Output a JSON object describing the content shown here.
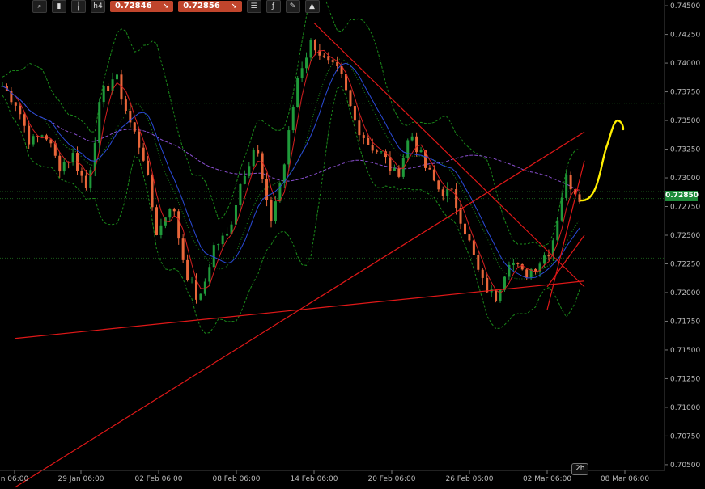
{
  "toolbar": {
    "tools": [
      {
        "icon": "zoom-icon",
        "glyph": "⌕"
      },
      {
        "icon": "bars-icon",
        "glyph": "▮"
      },
      {
        "icon": "candles-icon",
        "glyph": "╽"
      },
      {
        "icon": "timeframe-icon",
        "glyph": "h4"
      }
    ],
    "sell_price": "0.72846",
    "buy_price": "0.72856",
    "extra_tools": [
      {
        "icon": "indicators-icon",
        "glyph": "☰"
      },
      {
        "icon": "function-icon",
        "glyph": "ƒ"
      },
      {
        "icon": "objects-icon",
        "glyph": "✎"
      },
      {
        "icon": "template-icon",
        "glyph": "▲"
      }
    ]
  },
  "current_price": "0.72850",
  "timeframe_badge": "2h",
  "colors": {
    "bull": "#1f9a3a",
    "bear": "#e8663a",
    "ma_fast": "#d62020",
    "ma_slow": "#2a4bd8",
    "ma_long": "#8a4fd0",
    "bands": "#1a8a1a",
    "trendline": "#e01818",
    "annotation": "#ffee00",
    "grid": "#1a5a1a"
  },
  "chart_data": {
    "type": "candlestick",
    "symbol": "",
    "ylim": [
      0.7045,
      0.7455
    ],
    "y_ticks": [
      "0.74500",
      "0.74250",
      "0.74000",
      "0.73750",
      "0.73500",
      "0.73250",
      "0.73000",
      "0.72750",
      "0.72500",
      "0.72250",
      "0.72000",
      "0.71750",
      "0.71500",
      "0.71250",
      "0.71000",
      "0.70750",
      "0.70500"
    ],
    "x_ticks": [
      "n 06:00",
      "29 Jan 06:00",
      "02 Feb 06:00",
      "08 Feb 06:00",
      "14 Feb 06:00",
      "20 Feb 06:00",
      "26 Feb 06:00",
      "02 Mar 06:00",
      "08 Mar 06:00"
    ],
    "close_path": [
      0.738,
      0.7365,
      0.733,
      0.734,
      0.731,
      0.732,
      0.729,
      0.737,
      0.739,
      0.735,
      0.732,
      0.725,
      0.728,
      0.722,
      0.719,
      0.724,
      0.725,
      0.73,
      0.733,
      0.726,
      0.731,
      0.739,
      0.742,
      0.74,
      0.739,
      0.735,
      0.733,
      0.732,
      0.73,
      0.734,
      0.731,
      0.729,
      0.7285,
      0.725,
      0.721,
      0.7195,
      0.723,
      0.7215,
      0.7225,
      0.724,
      0.73,
      0.7285
    ],
    "horizontal_levels": [
      0.7365,
      0.7282,
      0.7288,
      0.723
    ],
    "trendlines": [
      {
        "from": [
          "n 06:00",
          0.716
        ],
        "to": [
          "08 Mar 06:00",
          0.721
        ]
      },
      {
        "from": [
          "n 06:00",
          0.703
        ],
        "to": [
          "08 Mar 06:00",
          0.734
        ]
      },
      {
        "from": [
          "14 Feb 06:00",
          0.7435
        ],
        "to": [
          "08 Mar 06:00",
          0.7205
        ]
      },
      {
        "from": [
          "02 Mar 06:00",
          0.7185
        ],
        "to": [
          "08 Mar 06:00",
          0.7315
        ]
      },
      {
        "from": [
          "02 Mar 06:00",
          0.7205
        ],
        "to": [
          "08 Mar 06:00",
          0.725
        ]
      }
    ],
    "grid": false,
    "legend": "none"
  }
}
